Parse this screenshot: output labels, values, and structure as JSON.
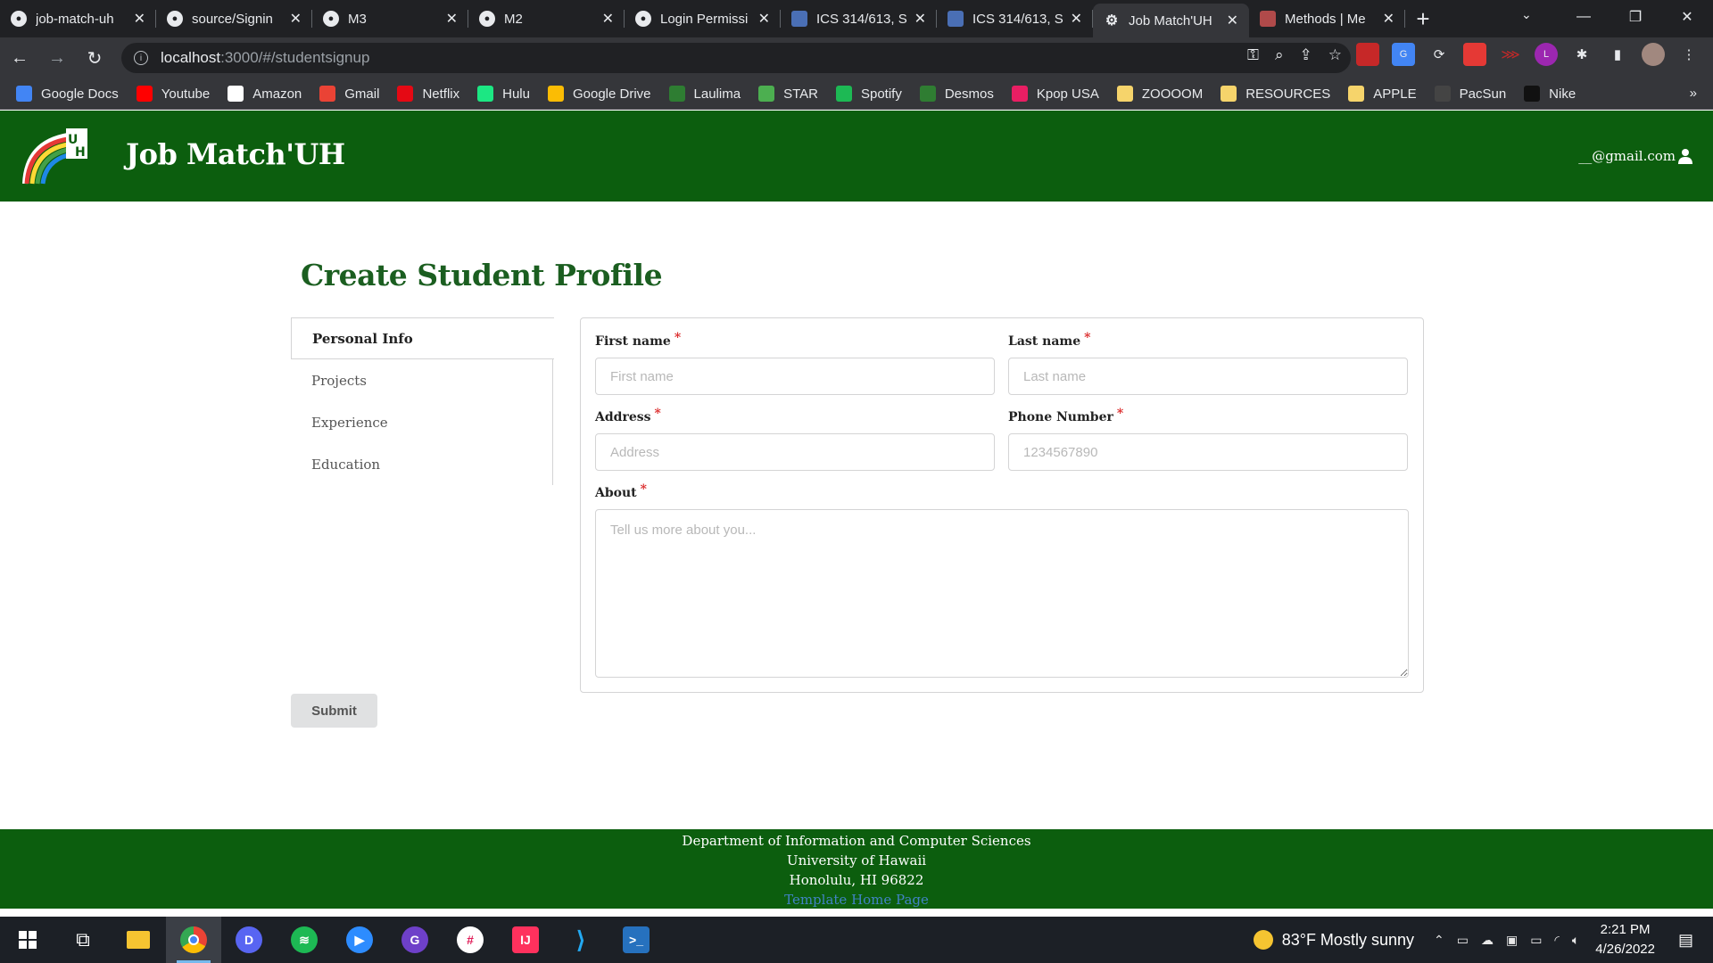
{
  "browser": {
    "tabs": [
      {
        "title": "job-match-uh",
        "icon": "github-icon"
      },
      {
        "title": "source/Signin",
        "icon": "github-icon"
      },
      {
        "title": "M3",
        "icon": "github-icon"
      },
      {
        "title": "M2",
        "icon": "github-icon"
      },
      {
        "title": "Login Permissi",
        "icon": "github-icon"
      },
      {
        "title": "ICS 314/613, S",
        "icon": "docs-icon"
      },
      {
        "title": "ICS 314/613, S",
        "icon": "docs-icon"
      },
      {
        "title": "Job Match'UH",
        "icon": "app-icon"
      },
      {
        "title": "Methods | Me",
        "icon": "hawaii-icon"
      }
    ],
    "address": {
      "host": "localhost",
      "path": ":3000/#/studentsignup"
    },
    "bookmarks": [
      {
        "label": "Google Docs",
        "color": "#4285f4"
      },
      {
        "label": "Youtube",
        "color": "#ff0000"
      },
      {
        "label": "Amazon",
        "color": "#ffffff"
      },
      {
        "label": "Gmail",
        "color": "#ea4335"
      },
      {
        "label": "Netflix",
        "color": "#e50914"
      },
      {
        "label": "Hulu",
        "color": "#1ce783"
      },
      {
        "label": "Google Drive",
        "color": "#fbbc04"
      },
      {
        "label": "Laulima",
        "color": "#2e7d32"
      },
      {
        "label": "STAR",
        "color": "#4caf50"
      },
      {
        "label": "Spotify",
        "color": "#1db954"
      },
      {
        "label": "Desmos",
        "color": "#2f7d32"
      },
      {
        "label": "Kpop USA",
        "color": "#e91e63"
      },
      {
        "label": "ZOOOOM",
        "color": "#f6d46b"
      },
      {
        "label": "RESOURCES",
        "color": "#f6d46b"
      },
      {
        "label": "APPLE",
        "color": "#f6d46b"
      },
      {
        "label": "PacSun",
        "color": "#444444"
      },
      {
        "label": "Nike",
        "color": "#111111"
      }
    ],
    "more": "»"
  },
  "app": {
    "brand": "Job Match'UH",
    "user_email": "__@gmail.com",
    "colors": {
      "primary": "#0c5e0e",
      "title": "#1b5e20",
      "required": "#db2828"
    }
  },
  "page": {
    "title": "Create Student Profile",
    "menu": [
      "Personal Info",
      "Projects",
      "Experience",
      "Education"
    ],
    "form": {
      "first_name": {
        "label": "First name",
        "placeholder": "First name"
      },
      "last_name": {
        "label": "Last name",
        "placeholder": "Last name"
      },
      "address": {
        "label": "Address",
        "placeholder": "Address"
      },
      "phone": {
        "label": "Phone Number",
        "placeholder": "1234567890"
      },
      "about": {
        "label": "About",
        "placeholder": "Tell us more about you..."
      },
      "required_mark": "*"
    },
    "submit_label": "Submit"
  },
  "footer": {
    "line1": "Department of Information and Computer Sciences",
    "line2": "University of Hawaii",
    "line3": "Honolulu, HI 96822",
    "link": "Template Home Page"
  },
  "taskbar": {
    "weather": "83°F  Mostly sunny",
    "time": "2:21 PM",
    "date": "4/26/2022"
  }
}
